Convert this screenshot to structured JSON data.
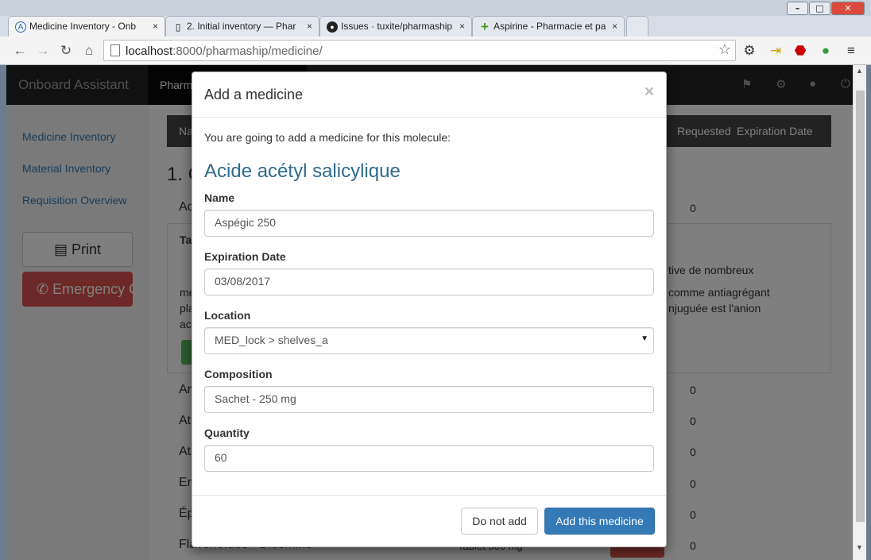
{
  "browser": {
    "tabs": [
      {
        "title": "Medicine Inventory - Onb",
        "icon": "app-icon"
      },
      {
        "title": "2. Initial inventory — Phar",
        "icon": "document-icon"
      },
      {
        "title": "Issues · tuxite/pharmaship",
        "icon": "github-icon"
      },
      {
        "title": "Aspirine - Pharmacie et pa",
        "icon": "green-cross-icon"
      }
    ],
    "tab_close": "×",
    "url_host": "localhost",
    "url_path": ":8000/pharmaship/medicine/"
  },
  "app": {
    "brand": "Onboard Assistant",
    "nav_active": "Pharm",
    "sidebar": [
      {
        "label": "Medicine Inventory"
      },
      {
        "label": "Material Inventory"
      },
      {
        "label": "Requisition Overview"
      }
    ],
    "print_label": "Print",
    "emergency_label": "Emergency Co",
    "table_header": {
      "col1": "Na",
      "col2": "Requested",
      "col3": "Expiration Date"
    },
    "heading": "1. C",
    "rows": [
      {
        "label": "Ac",
        "count": "0"
      },
      {
        "label": "Ar",
        "count": "0"
      },
      {
        "label": "At",
        "count": "0"
      },
      {
        "label": "At",
        "count": "0"
      },
      {
        "label": "Er",
        "count": "0"
      },
      {
        "label": "Ép",
        "count": "0"
      },
      {
        "label": "Flavonoïdes - Diosmine",
        "count": "0"
      }
    ],
    "panel_label": "Ta",
    "panel_text": {
      "line1": "tive de nombreux",
      "line2": "comme antiagrégant",
      "line3": "njuguée est l'anion",
      "left1": "me",
      "left2": "pla",
      "left3": "ac"
    },
    "dose_fragment": "Tablet 500 mg"
  },
  "modal": {
    "title": "Add a medicine",
    "close": "×",
    "intro": "You are going to add a medicine for this molecule:",
    "molecule": "Acide acétyl salicylique",
    "fields": {
      "name": {
        "label": "Name",
        "value": "Aspégic 250"
      },
      "expiration": {
        "label": "Expiration Date",
        "value": "03/08/2017"
      },
      "location": {
        "label": "Location",
        "value": "MED_lock > shelves_a"
      },
      "composition": {
        "label": "Composition",
        "value": "Sachet - 250 mg"
      },
      "quantity": {
        "label": "Quantity",
        "value": "60"
      }
    },
    "cancel_label": "Do not add",
    "submit_label": "Add this medicine"
  }
}
